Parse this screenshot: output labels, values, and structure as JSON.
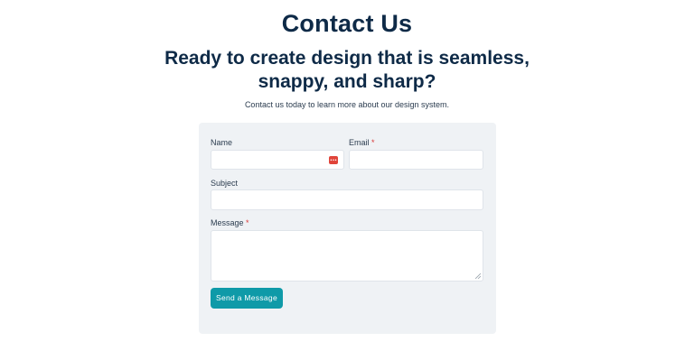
{
  "page": {
    "title": "Contact Us",
    "headline": "Ready to create design that is seamless, snappy, and sharp?",
    "subtext": "Contact us today to learn more about our design system."
  },
  "form": {
    "name_label": "Name",
    "email_label": "Email",
    "subject_label": "Subject",
    "message_label": "Message",
    "required_marker": "*",
    "name_value": "",
    "email_value": "",
    "subject_value": "",
    "message_value": "",
    "submit_label": "Send a Message"
  },
  "colors": {
    "heading": "#0e2a47",
    "card_background": "#eff2f5",
    "button": "#0f9aa8",
    "required": "#d93a3a"
  },
  "icons": {
    "autofill": "password-manager-autofill-icon"
  }
}
